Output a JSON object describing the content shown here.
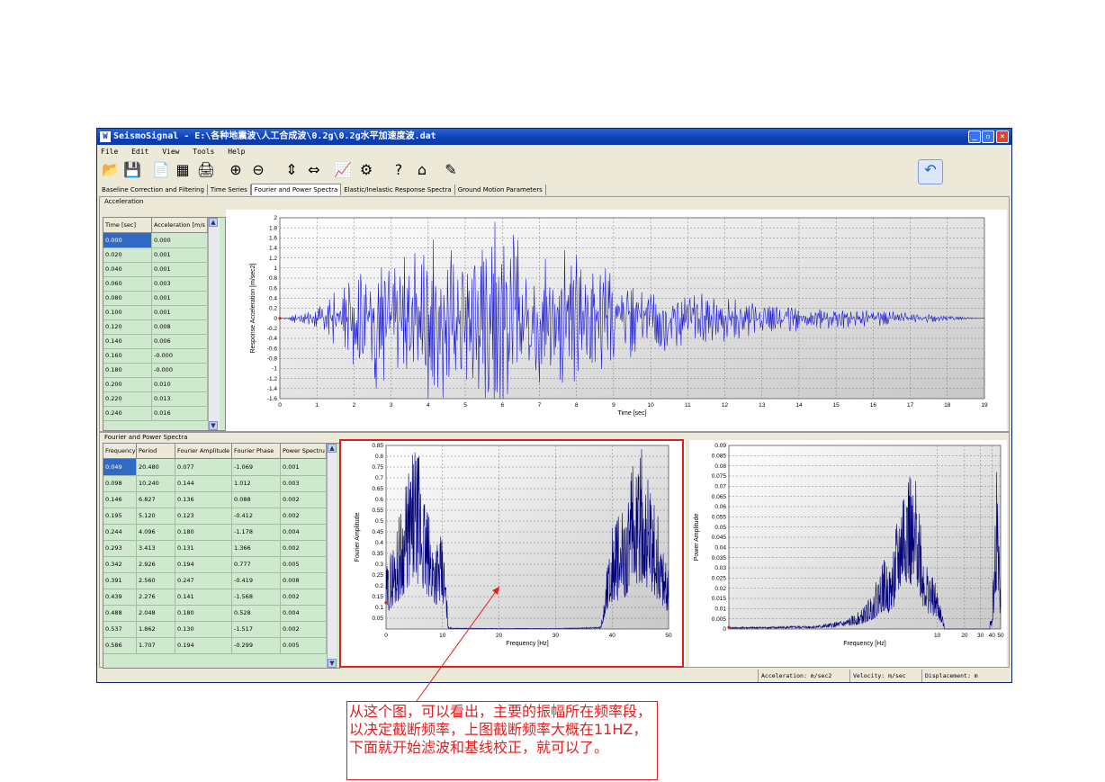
{
  "window": {
    "title": "SeismoSignal - E:\\各种地震波\\人工合成波\\0.2g\\0.2g水平加速度波.dat",
    "app_icon": "W"
  },
  "menu": [
    "File",
    "Edit",
    "View",
    "Tools",
    "Help"
  ],
  "toolbar": {
    "icons": [
      "open-folder-icon",
      "save-icon",
      "new-document-icon",
      "signal-icon",
      "print-icon",
      "zoom-in-icon",
      "zoom-out-icon",
      "vertical-arrows-icon",
      "horizontal-arrows-icon",
      "chart-icon",
      "settings-gear-icon",
      "help-icon",
      "home-icon",
      "edit-icon"
    ],
    "glyphs": [
      "📂",
      "💾",
      "📄",
      "▦",
      "🖨",
      "⊕",
      "⊖",
      "⇕",
      "⇔",
      "📈",
      "⚙",
      "?",
      "⌂",
      "✎"
    ],
    "right_icon": "back-arrow-icon"
  },
  "tabs": [
    "Baseline Correction and Filtering",
    "Time Series",
    "Fourier and Power Spectra",
    "Elastic/Inelastic Response Spectra",
    "Ground Motion Parameters"
  ],
  "active_tab": 2,
  "accel_panel": {
    "label": "Acceleration",
    "columns": [
      "Time [sec]",
      "Acceleration [m/s"
    ],
    "rows": [
      [
        "0.000",
        "0.000"
      ],
      [
        "0.020",
        "0.001"
      ],
      [
        "0.040",
        "0.001"
      ],
      [
        "0.060",
        "0.003"
      ],
      [
        "0.080",
        "0.001"
      ],
      [
        "0.100",
        "0.001"
      ],
      [
        "0.120",
        "0.008"
      ],
      [
        "0.140",
        "0.006"
      ],
      [
        "0.160",
        "-0.000"
      ],
      [
        "0.180",
        "-0.000"
      ],
      [
        "0.200",
        "0.010"
      ],
      [
        "0.220",
        "0.013"
      ],
      [
        "0.240",
        "0.016"
      ]
    ]
  },
  "fourier_panel": {
    "label": "Fourier and Power Spectra",
    "columns": [
      "Frequency",
      "Period",
      "Fourier Amplitude",
      "Fourier Phase",
      "Power Spectru"
    ],
    "rows": [
      [
        "0.049",
        "20.480",
        "0.077",
        "-1.069",
        "0.001"
      ],
      [
        "0.098",
        "10.240",
        "0.144",
        "1.012",
        "0.003"
      ],
      [
        "0.146",
        "6.827",
        "0.136",
        "0.088",
        "0.002"
      ],
      [
        "0.195",
        "5.120",
        "0.123",
        "-0.412",
        "0.002"
      ],
      [
        "0.244",
        "4.096",
        "0.180",
        "-1.178",
        "0.004"
      ],
      [
        "0.293",
        "3.413",
        "0.131",
        "1.366",
        "0.002"
      ],
      [
        "0.342",
        "2.926",
        "0.194",
        "0.777",
        "0.005"
      ],
      [
        "0.391",
        "2.560",
        "0.247",
        "-0.419",
        "0.008"
      ],
      [
        "0.439",
        "2.276",
        "0.141",
        "-1.568",
        "0.002"
      ],
      [
        "0.488",
        "2.048",
        "0.180",
        "0.528",
        "0.004"
      ],
      [
        "0.537",
        "1.862",
        "0.130",
        "-1.517",
        "0.002"
      ],
      [
        "0.586",
        "1.707",
        "0.194",
        "-0.299",
        "0.005"
      ]
    ]
  },
  "statusbar": [
    "Acceleration: m/sec2",
    "Velocity: m/sec",
    "Displacement: m"
  ],
  "annotation": "从这个图，可以看出，主要的振幅所在频率段，以决定截断频率，上图截断频率大概在11HZ，下面就开始滤波和基线校正，就可以了。",
  "colors": {
    "series": "#1a1ad0",
    "dark_series": "#00007a",
    "highlight": "#e02020",
    "grid_bg": "#cfe9cf"
  },
  "chart_data": [
    {
      "type": "line",
      "title": "",
      "xlabel": "Time [sec]",
      "ylabel": "Response Acceleration [m/sec2]",
      "xlim": [
        0,
        19
      ],
      "ylim": [
        -1.6,
        2
      ],
      "xticks": [
        0,
        1,
        2,
        3,
        4,
        5,
        6,
        7,
        8,
        9,
        10,
        11,
        12,
        13,
        14,
        15,
        16,
        17,
        18,
        19
      ],
      "yticks": [
        -1.6,
        -1.4,
        -1.2,
        -1,
        -0.8,
        -0.6,
        -0.4,
        -0.2,
        0,
        0.2,
        0.4,
        0.6,
        0.8,
        1,
        1.2,
        1.4,
        1.6,
        1.8,
        2
      ],
      "envelope": {
        "x": [
          0,
          1,
          2,
          3,
          4,
          5,
          6,
          7,
          8,
          9,
          10,
          11,
          12,
          13,
          14,
          15,
          16,
          17,
          18,
          19
        ],
        "y": [
          0,
          0.2,
          0.9,
          1.3,
          1.5,
          1.3,
          1.9,
          1.3,
          1.3,
          0.9,
          0.7,
          0.55,
          0.45,
          0.3,
          0.25,
          0.2,
          0.15,
          0.1,
          0.05,
          0
        ]
      },
      "peaks": [
        {
          "x": 5.8,
          "y": 1.92
        },
        {
          "x": 2.6,
          "y": -1.4
        },
        {
          "x": 4.4,
          "y": -1.58
        }
      ],
      "grid": true
    },
    {
      "type": "line",
      "title": "",
      "xlabel": "Frequency [Hz]",
      "ylabel": "Fourier Amplitude",
      "xlim": [
        0,
        50
      ],
      "ylim": [
        0,
        0.85
      ],
      "xticks": [
        0,
        10,
        20,
        30,
        40,
        50
      ],
      "yticks": [
        0.05,
        0.1,
        0.15,
        0.2,
        0.25,
        0.3,
        0.35,
        0.4,
        0.45,
        0.5,
        0.55,
        0.6,
        0.65,
        0.7,
        0.75,
        0.8,
        0.85
      ],
      "envelope": {
        "x": [
          0,
          2,
          4,
          5,
          6,
          7,
          8,
          10,
          10.5,
          11,
          12,
          20,
          30,
          38,
          38.5,
          39,
          40,
          42,
          44,
          45,
          46,
          47,
          48,
          50
        ],
        "y": [
          0.28,
          0.5,
          0.75,
          0.85,
          0.82,
          0.6,
          0.48,
          0.42,
          0.3,
          0.01,
          0.005,
          0.003,
          0.003,
          0.01,
          0.12,
          0.3,
          0.5,
          0.55,
          0.8,
          0.85,
          0.8,
          0.6,
          0.55,
          0.28
        ]
      },
      "grid": true
    },
    {
      "type": "line",
      "title": "",
      "xlabel": "Frequency [Hz]",
      "ylabel": "Power Amplitude",
      "xscale": "log",
      "xlim": [
        0.05,
        50
      ],
      "ylim": [
        0,
        0.09
      ],
      "xticks": [
        10,
        20,
        30,
        40,
        50
      ],
      "yticks": [
        0,
        0.005,
        0.01,
        0.015,
        0.02,
        0.025,
        0.03,
        0.035,
        0.04,
        0.045,
        0.05,
        0.055,
        0.06,
        0.065,
        0.07,
        0.075,
        0.08,
        0.085,
        0.09
      ],
      "envelope": {
        "x": [
          0.05,
          0.5,
          1,
          1.5,
          2,
          2.5,
          3,
          3.5,
          4,
          4.5,
          5,
          5.5,
          6,
          7,
          8,
          10,
          12,
          20,
          30,
          40,
          42,
          44,
          45,
          46,
          48,
          50
        ],
        "y": [
          0.001,
          0.002,
          0.005,
          0.01,
          0.02,
          0.035,
          0.03,
          0.05,
          0.07,
          0.09,
          0.08,
          0.06,
          0.085,
          0.04,
          0.03,
          0.02,
          0.001,
          0.0005,
          0.0005,
          0.005,
          0.03,
          0.06,
          0.08,
          0.09,
          0.04,
          0.02
        ]
      },
      "grid": true
    }
  ]
}
